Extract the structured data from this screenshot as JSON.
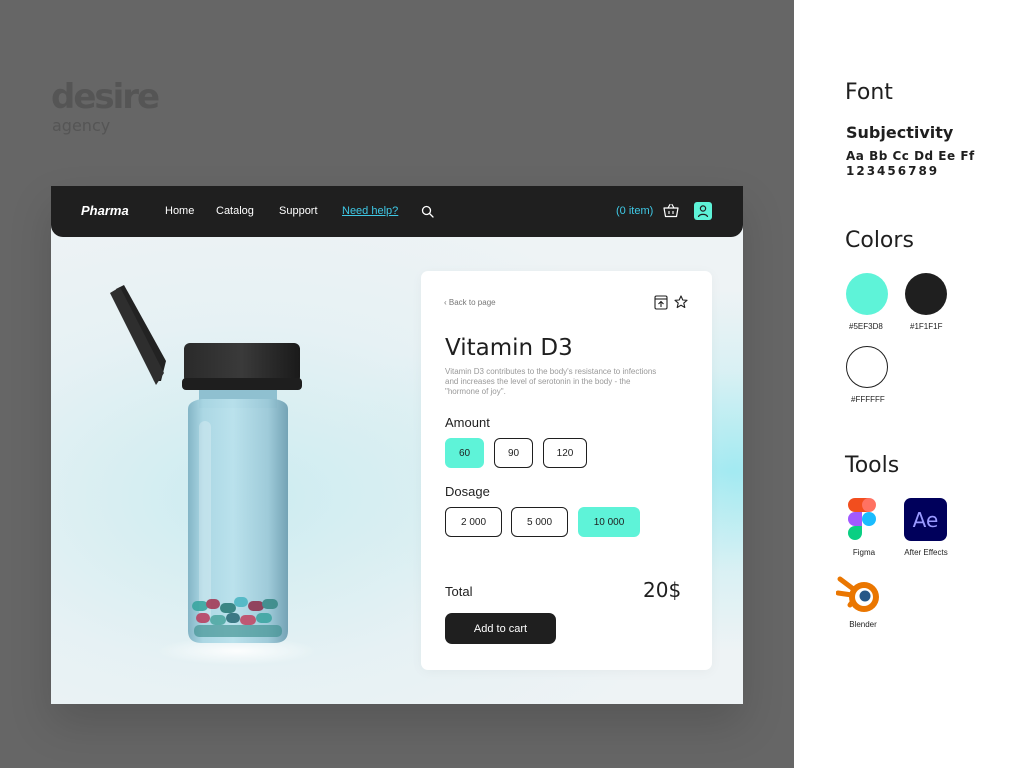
{
  "brand": {
    "name": "desire",
    "sub": "agency"
  },
  "nav": {
    "logo": "Pharma",
    "links": [
      "Home",
      "Catalog",
      "Support"
    ],
    "help": "Need help?",
    "cart": "(0 item)"
  },
  "product": {
    "back": "‹ Back to page",
    "title": "Vitamin D3",
    "description": "Vitamin D3 contributes to the body's resistance to infections and increases the level of serotonin in the body - the \"hormone of joy\".",
    "amount_label": "Amount",
    "amount_options": [
      "60",
      "90",
      "120"
    ],
    "amount_selected": "60",
    "dosage_label": "Dosage",
    "dosage_options": [
      "2 000",
      "5 000",
      "10 000"
    ],
    "dosage_selected": "10 000",
    "total_label": "Total",
    "total_value": "20$",
    "add_to_cart": "Add to cart"
  },
  "style_guide": {
    "font_heading": "Font",
    "font_name": "Subjectivity",
    "font_sample_letters": "Aa Bb Cc Dd Ee Ff",
    "font_sample_digits": "123456789",
    "colors_heading": "Colors",
    "colors": [
      {
        "hex": "#5EF3D8",
        "value": "#5ef3d8"
      },
      {
        "hex": "#1F1F1F",
        "value": "#1f1f1f"
      },
      {
        "hex": "#FFFFFF",
        "value": "#ffffff"
      }
    ],
    "tools_heading": "Tools",
    "tools": [
      "Figma",
      "After Effects",
      "Blender"
    ],
    "ae_text": "Ae"
  }
}
